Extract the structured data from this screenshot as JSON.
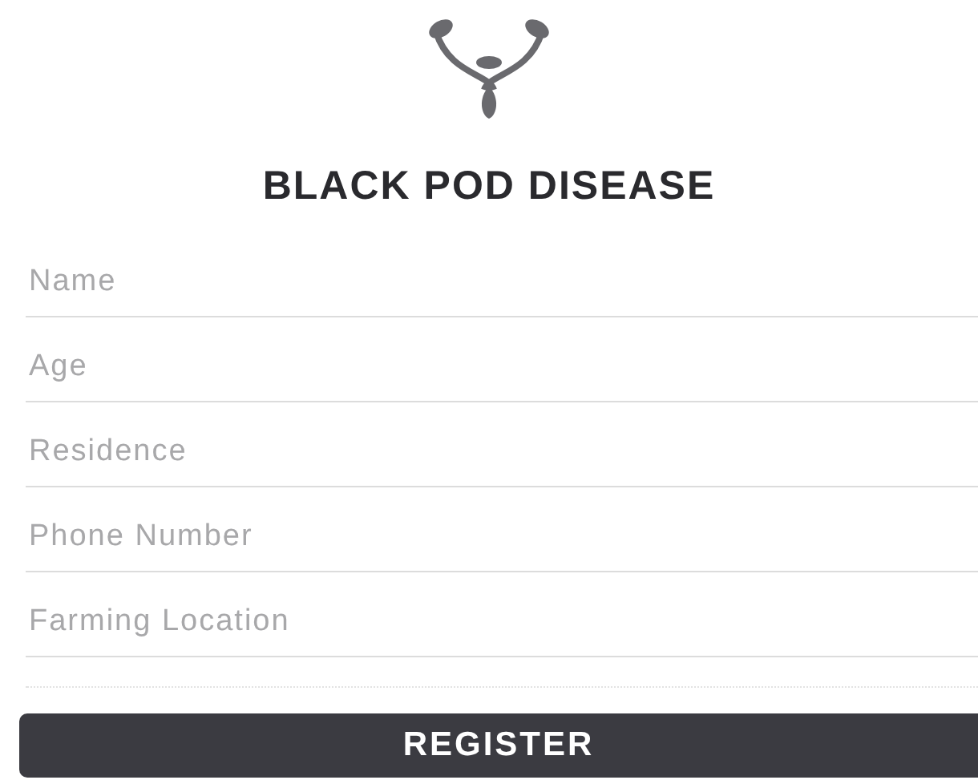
{
  "title": "BLACK POD DISEASE",
  "fields": [
    {
      "placeholder": "Name"
    },
    {
      "placeholder": "Age"
    },
    {
      "placeholder": "Residence"
    },
    {
      "placeholder": "Phone Number"
    },
    {
      "placeholder": "Farming Location"
    }
  ],
  "button": "REGISTER"
}
